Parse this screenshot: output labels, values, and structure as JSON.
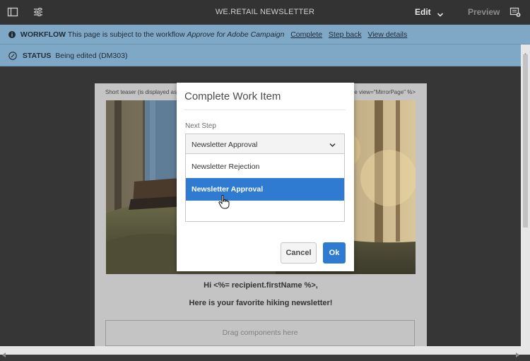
{
  "topbar": {
    "title": "WE.RETAIL NEWSLETTER",
    "mode_label": "Edit",
    "preview_label": "Preview"
  },
  "workflow_bar": {
    "label": "WORKFLOW",
    "text_prefix": "This page is subject to the workflow",
    "workflow_name": "Approve for Adobe Campaign",
    "links": [
      "Complete",
      "Step back",
      "View details"
    ]
  },
  "status_bar": {
    "label": "STATUS",
    "text": "Being edited (DM303)"
  },
  "page": {
    "teaser_left": "Short teaser (is displayed as",
    "teaser_right": "de view=\"MirrorPage\" %>",
    "greeting": "Hi <%= recipient.firstName %>,",
    "subtitle": "Here is your favorite hiking newsletter!",
    "dropzone": "Drag components here"
  },
  "modal": {
    "title": "Complete Work Item",
    "field_label": "Next Step",
    "selected_value": "Newsletter Approval",
    "options": [
      "Newsletter Rejection",
      "Newsletter Approval"
    ],
    "cancel_label": "Cancel",
    "ok_label": "Ok"
  },
  "colors": {
    "topbar_bg": "#333333",
    "info_bar_bg": "#7fa8c7",
    "accent_blue": "#2f7bd2"
  },
  "icons": [
    "sidebar-toggle-icon",
    "properties-icon",
    "chevron-down-icon",
    "annotate-icon",
    "info-icon",
    "status-icon",
    "hand-cursor-icon"
  ]
}
